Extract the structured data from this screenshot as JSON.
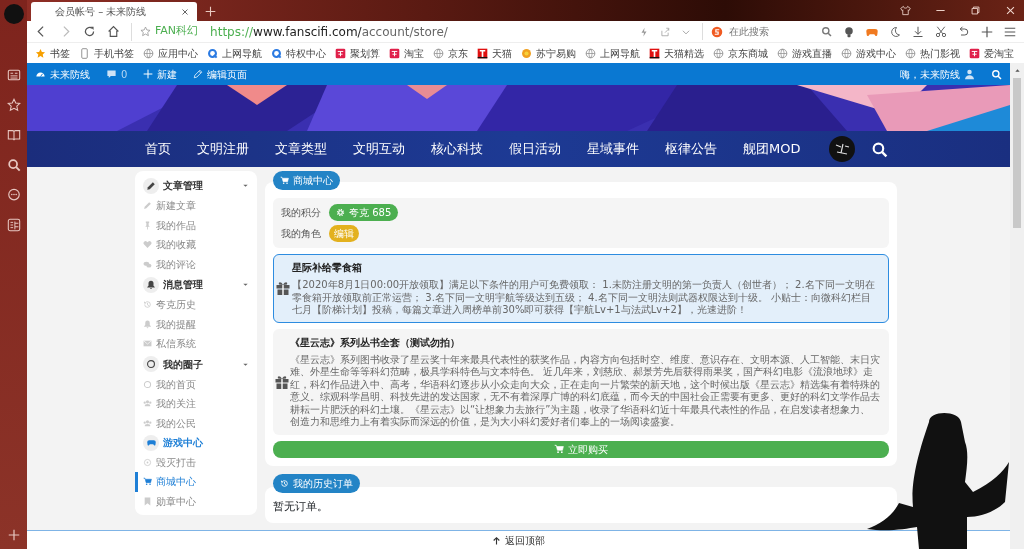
{
  "browser": {
    "tab_title": "会员帐号 – 未来防线",
    "site_label": "FAN科幻",
    "url": "https://www.fanscifi.com/account/store/",
    "search_placeholder": "在此搜索",
    "bookmarks": [
      {
        "label": "书签",
        "kind": "star"
      },
      {
        "label": "手机书签",
        "kind": "phone"
      },
      {
        "label": "应用中心",
        "kind": "globe"
      },
      {
        "label": "上网导航",
        "kind": "q"
      },
      {
        "label": "特权中心",
        "kind": "q"
      },
      {
        "label": "聚划算",
        "kind": "red"
      },
      {
        "label": "淘宝",
        "kind": "red"
      },
      {
        "label": "京东",
        "kind": "globe"
      },
      {
        "label": "天猫",
        "kind": "tmall"
      },
      {
        "label": "苏宁易购",
        "kind": "flower"
      },
      {
        "label": "上网导航",
        "kind": "globe"
      },
      {
        "label": "天猫精选",
        "kind": "tmall"
      },
      {
        "label": "京东商城",
        "kind": "globe"
      },
      {
        "label": "游戏直播",
        "kind": "globe"
      },
      {
        "label": "游戏中心",
        "kind": "globe"
      },
      {
        "label": "热门影视",
        "kind": "globe"
      },
      {
        "label": "爱淘宝",
        "kind": "red"
      }
    ]
  },
  "admin_bar": {
    "site": "未来防线",
    "comments": "0",
    "new": "新建",
    "edit": "编辑页面",
    "greeting": "嗨，未来防线"
  },
  "nav": {
    "items": [
      "首页",
      "文明注册",
      "文章类型",
      "文明互动",
      "核心科技",
      "假日活动",
      "星域事件",
      "枢律公告",
      "舰团MOD"
    ]
  },
  "sidebar": {
    "groups": [
      {
        "title": "文章管理",
        "items": [
          {
            "label": "新建文章",
            "selected": false,
            "highlighted": false
          },
          {
            "label": "我的作品",
            "selected": false,
            "highlighted": false
          },
          {
            "label": "我的收藏",
            "selected": false,
            "highlighted": false
          },
          {
            "label": "我的评论",
            "selected": false,
            "highlighted": false
          }
        ]
      },
      {
        "title": "消息管理",
        "items": [
          {
            "label": "夸克历史",
            "selected": false,
            "highlighted": false
          },
          {
            "label": "我的提醒",
            "selected": false,
            "highlighted": false
          },
          {
            "label": "私信系统",
            "selected": false,
            "highlighted": false
          }
        ]
      },
      {
        "title": "我的圈子",
        "items": [
          {
            "label": "我的首页",
            "selected": false,
            "highlighted": false
          },
          {
            "label": "我的关注",
            "selected": false,
            "highlighted": false
          },
          {
            "label": "我的公民",
            "selected": false,
            "highlighted": false
          },
          {
            "label": "游戏中心",
            "selected": false,
            "highlighted": true
          },
          {
            "label": "毁灭打击",
            "selected": false,
            "highlighted": false
          },
          {
            "label": "商城中心",
            "selected": true,
            "highlighted": false
          },
          {
            "label": "勋章中心",
            "selected": false,
            "highlighted": false
          }
        ]
      }
    ]
  },
  "store": {
    "badge": "商城中心",
    "points_label": "我的积分",
    "points": "夸克 685",
    "role_label": "我的角色",
    "role": "编辑",
    "products": [
      {
        "title": "星际补给零食箱",
        "selected": true,
        "description": "【2020年8月1日00:00开放领取】满足以下条件的用户可免费领取： 1.未防注册文明的第一负责人（创世者）； 2.名下同一文明在零食箱开放领取前正常运营； 3.名下同一文明宇航等级达到五级； 4.名下同一文明法则武器权限达到十级。 小贴士：向微科幻栏目七月【阶梯计划】投稿，每篇文章进入周榜单前30%即可获得【宇航Lv+1与法武Lv+2】，光速进阶！"
      },
      {
        "title": "《星云志》系列丛书全套（测试勿拍）",
        "selected": false,
        "description": "《星云志》系列图书收录了星云奖十年来最具代表性的获奖作品，内容方向包括时空、维度、意识存在、文明本源、人工智能、末日灾难、外星生命等等科幻范畴，极具学科特色与文本特色。 近几年来，刘慈欣、郝景芳先后获得雨果奖，国产科幻电影《流浪地球》走红，科幻作品进入中、高考，华语科幻逐步从小众走向大众，正在走向一片繁荣的新天地，这个时候出版《星云志》精选集有着特殊的意义。综观科学昌明、科技先进的发达国家，无不有着深厚广博的科幻底蕴，而今天的中国社会正需要有更多、更好的科幻文学作品去耕耘一片肥沃的科幻土壤。《星云志》以“让想象力去旅行”为主题，收录了华语科幻近十年最具代表性的作品，在启发读者想象力、创造力和思维力上有着实际而深远的价值，是为大小科幻爱好者们奉上的一场阅读盛宴。"
      }
    ],
    "buy_button": "立即购买"
  },
  "history": {
    "badge": "我的历史订单",
    "empty": "暂无订单。"
  },
  "footer": {
    "back_to_top": "返回顶部"
  }
}
